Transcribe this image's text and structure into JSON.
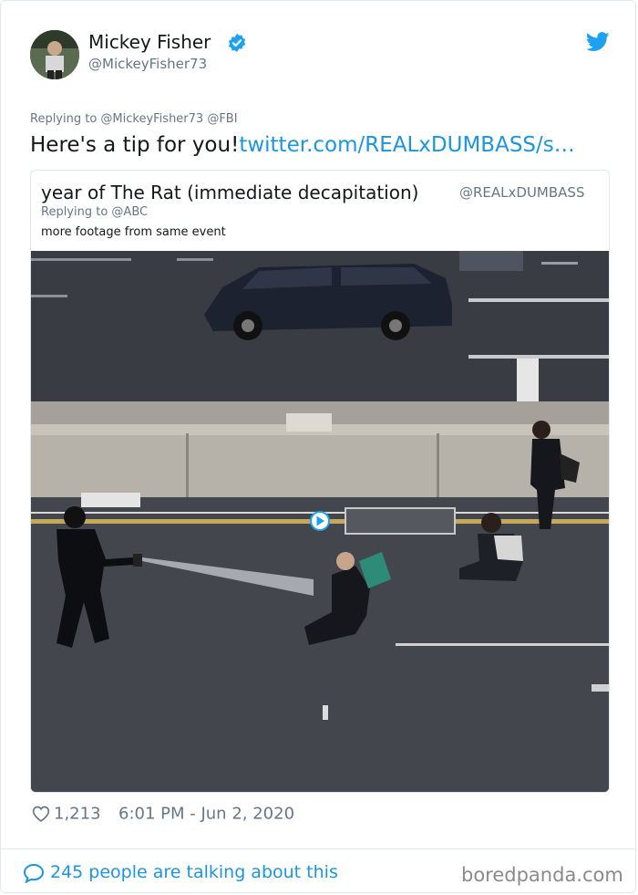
{
  "author": {
    "name": "Mickey Fisher",
    "handle": "@MickeyFisher73",
    "verified": true
  },
  "tweet": {
    "replying_to": "Replying to @MickeyFisher73 @FBI",
    "text": "Here's a tip for you!",
    "link": "twitter.com/REALxDUMBASS/s…"
  },
  "quoted": {
    "name": "year of The Rat (immediate decapitation)",
    "handle": "@REALxDUMBASS",
    "replying_to": "Replying to @ABC",
    "text": "more footage from same event"
  },
  "meta": {
    "likes": "1,213",
    "timestamp": "6:01 PM - Jun 2, 2020"
  },
  "footer": {
    "talking": "245 people are talking about this"
  },
  "watermark": "boredpanda.com",
  "colors": {
    "accent": "#1b95e0",
    "muted": "#657786",
    "verified": "#1da1f2"
  },
  "icons": [
    "verified-badge-icon",
    "twitter-bird-icon",
    "heart-icon",
    "speech-bubble-icon",
    "play-icon"
  ]
}
